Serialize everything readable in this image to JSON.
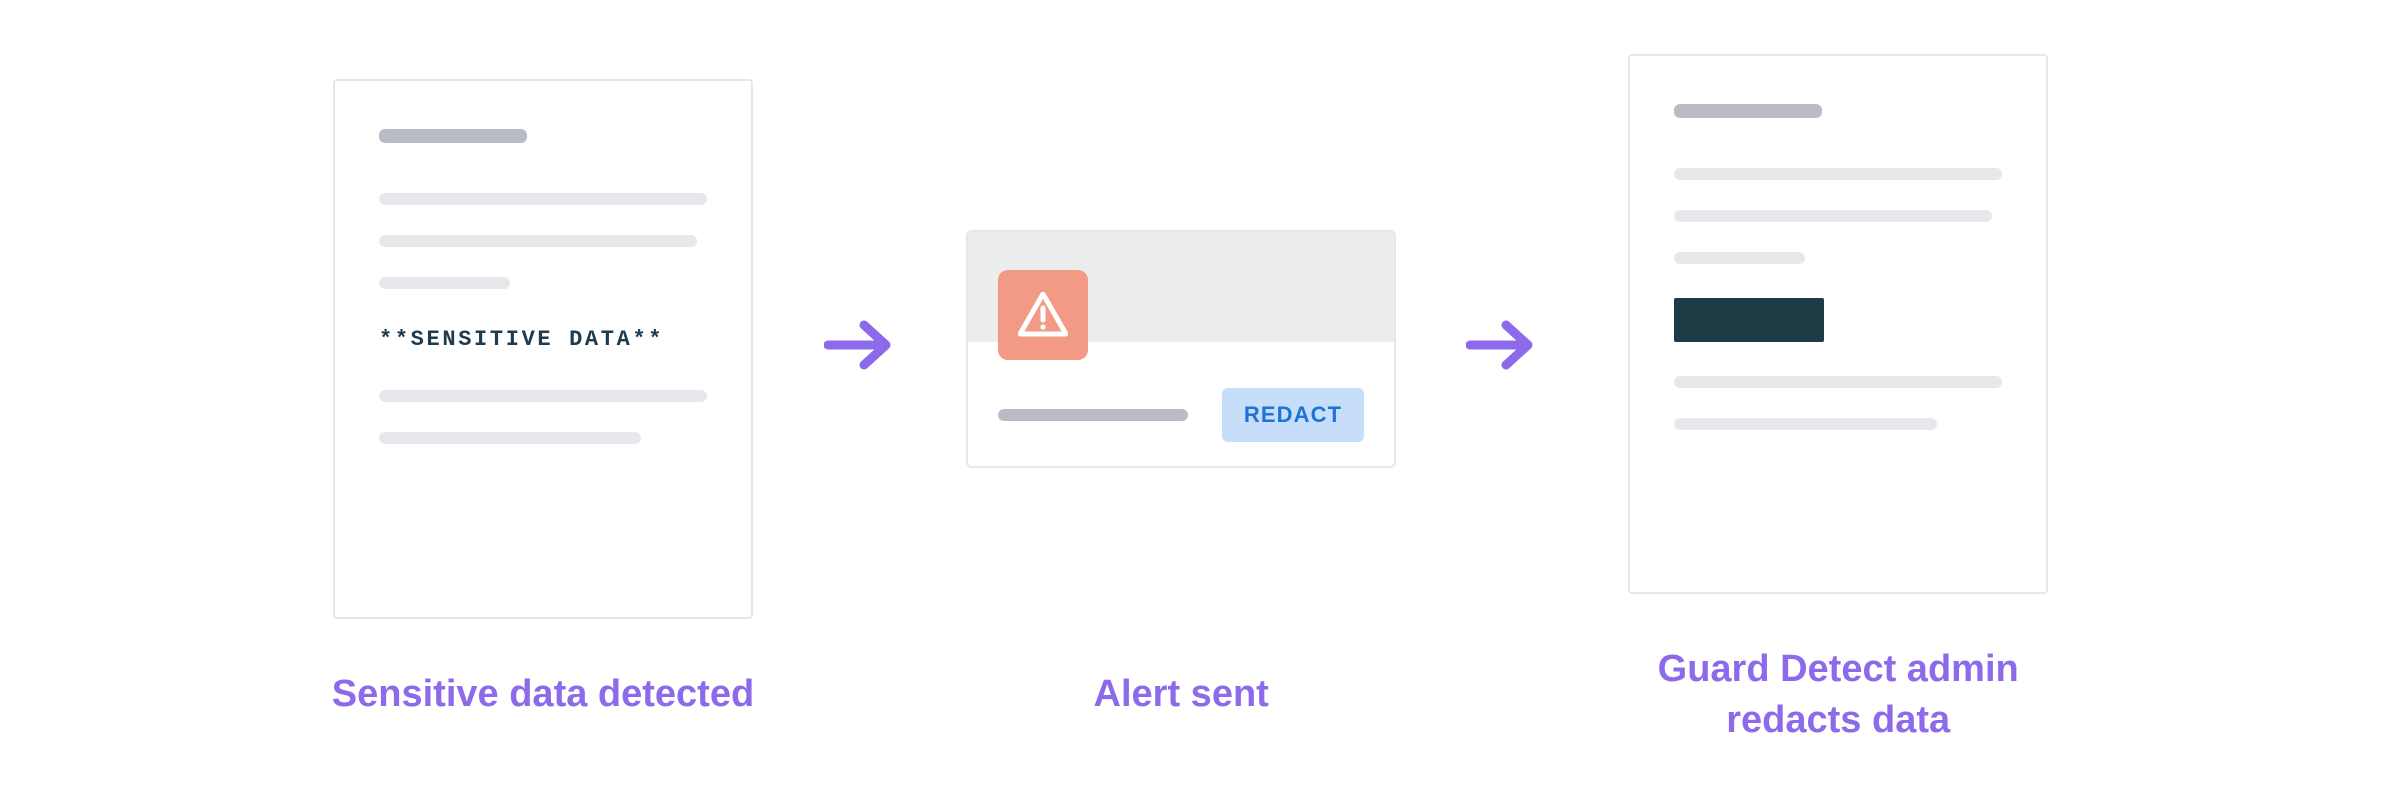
{
  "colors": {
    "accent_purple": "#8d6aea",
    "alert_badge": "#f29a86",
    "redact_button_bg": "#c6def9",
    "redact_button_text": "#1e73d9",
    "redacted_block": "#1e3a45"
  },
  "steps": {
    "step1": {
      "caption": "Sensitive data detected",
      "sensitive_label": "**SENSITIVE DATA**"
    },
    "step2": {
      "caption": "Alert sent",
      "button_label": "REDACT"
    },
    "step3": {
      "caption": "Guard Detect admin redacts data"
    }
  }
}
